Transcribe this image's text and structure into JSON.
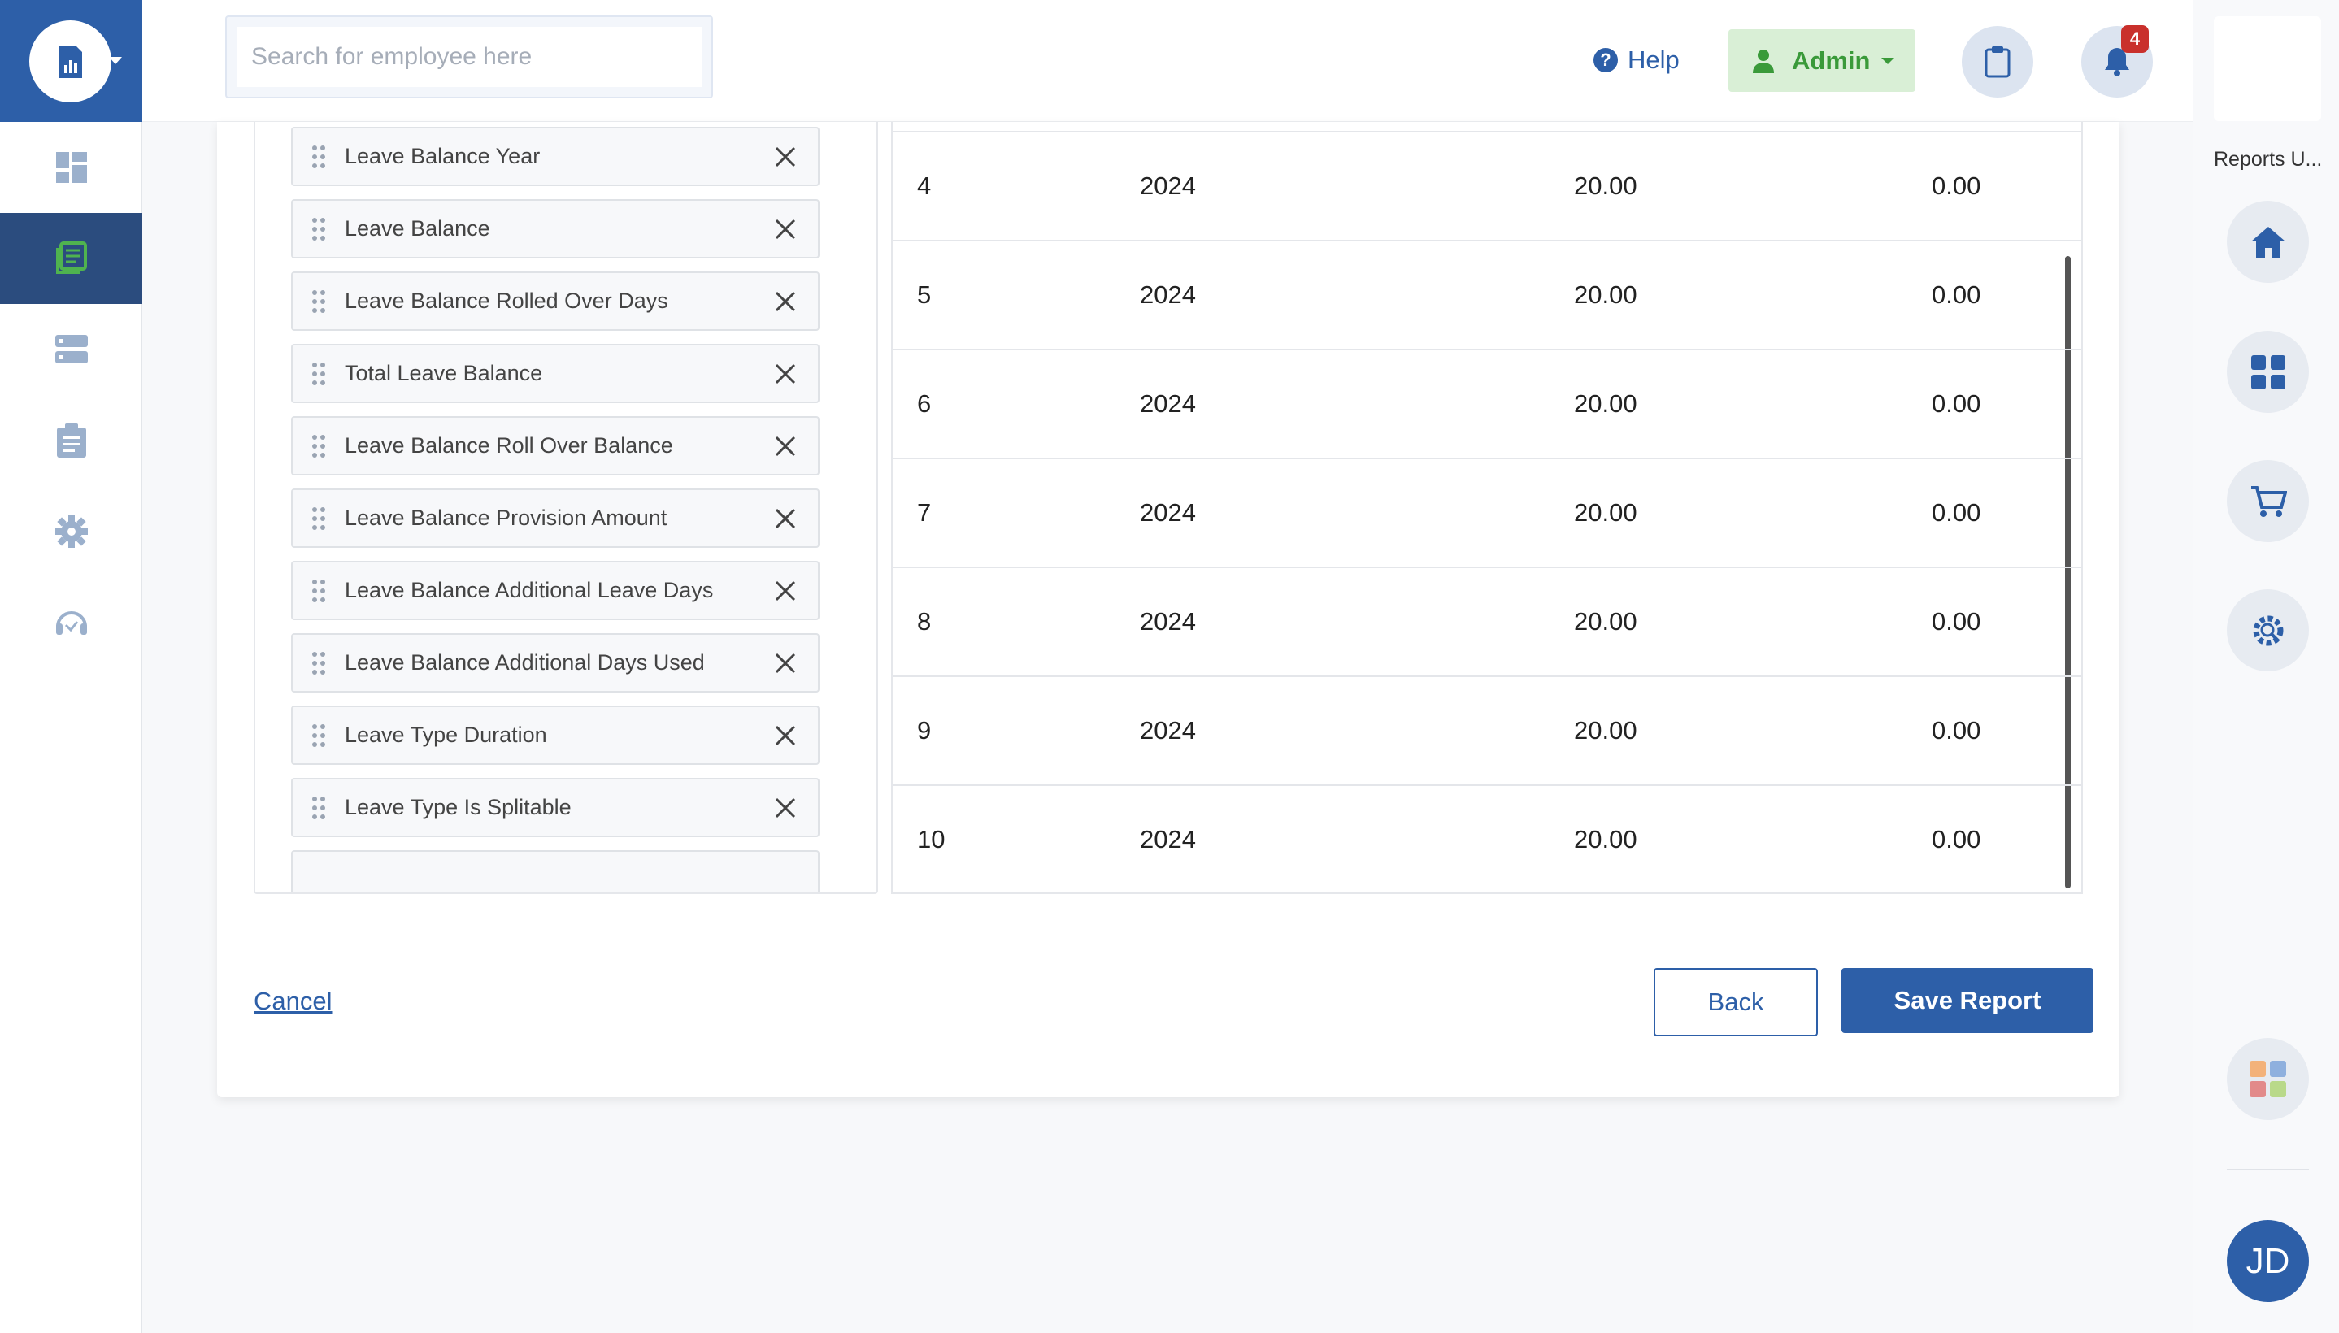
{
  "search": {
    "placeholder": "Search for employee here"
  },
  "topbar": {
    "help_label": "Help",
    "admin_label": "Admin",
    "notification_count": "4"
  },
  "sidebar": {
    "icons": [
      "reports-logo-icon",
      "dashboard-icon",
      "reports-icon",
      "server-icon",
      "clipboard-icon",
      "settings-gear-icon",
      "support-headset-icon"
    ],
    "active_item": "reports-icon"
  },
  "rail": {
    "title": "Reports U...",
    "buttons": [
      "home-icon",
      "apps-grid-icon",
      "cart-icon",
      "settings-search-icon",
      "color-apps-icon"
    ],
    "avatar_initials": "JD"
  },
  "fields": [
    "Leave Balance Year",
    "Leave Balance",
    "Leave Balance Rolled Over Days",
    "Total Leave Balance",
    "Leave Balance Roll Over Balance",
    "Leave Balance Provision Amount",
    "Leave Balance Additional Leave Days",
    "Leave Balance Additional Days Used",
    "Leave Type Duration",
    "Leave Type Is Splitable"
  ],
  "table": {
    "rows": [
      [
        "4",
        "2024",
        "20.00",
        "0.00"
      ],
      [
        "5",
        "2024",
        "20.00",
        "0.00"
      ],
      [
        "6",
        "2024",
        "20.00",
        "0.00"
      ],
      [
        "7",
        "2024",
        "20.00",
        "0.00"
      ],
      [
        "8",
        "2024",
        "20.00",
        "0.00"
      ],
      [
        "9",
        "2024",
        "20.00",
        "0.00"
      ],
      [
        "10",
        "2024",
        "20.00",
        "0.00"
      ]
    ]
  },
  "actions": {
    "cancel_label": "Cancel",
    "back_label": "Back",
    "save_label": "Save Report"
  },
  "colors": {
    "brand": "#2d5fa8",
    "admin_green": "#3a9a3a",
    "badge_red": "#c9302c"
  }
}
